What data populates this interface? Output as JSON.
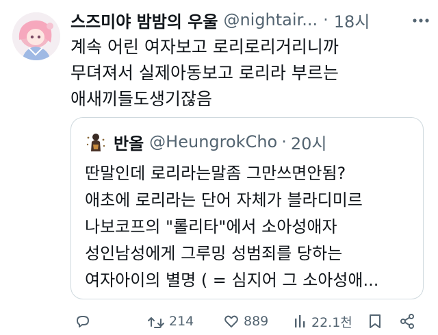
{
  "tweet": {
    "author_name": "스즈미야 밤밤의 우울",
    "handle": "@nightair...",
    "separator": "·",
    "time": "18시",
    "text_lines": [
      "계속 어린 여자보고 로리로리거리니까",
      "무뎌져서 실제아동보고 로리라 부르는",
      "애새끼들도생기잖음"
    ]
  },
  "quote": {
    "author_name": "반올",
    "handle": "@HeungrokCho",
    "separator": "·",
    "time": "20시",
    "text_lines": [
      "딴말인데 로리라는말좀 그만쓰면안됨?",
      "애초에 로리라는 단어 자체가 블라디미르",
      "나보코프의 \"롤리타\"에서 소아성애자",
      "성인남성에게 그루밍 성범죄를 당하는",
      "여자아이의 별명 ( = 심지어 그 소아성애..."
    ]
  },
  "actions": {
    "reply_count": "",
    "retweet_count": "214",
    "like_count": "889",
    "view_count": "22.1천"
  },
  "colors": {
    "text": "#0f1419",
    "secondary": "#536471",
    "border": "#cfd9de"
  }
}
